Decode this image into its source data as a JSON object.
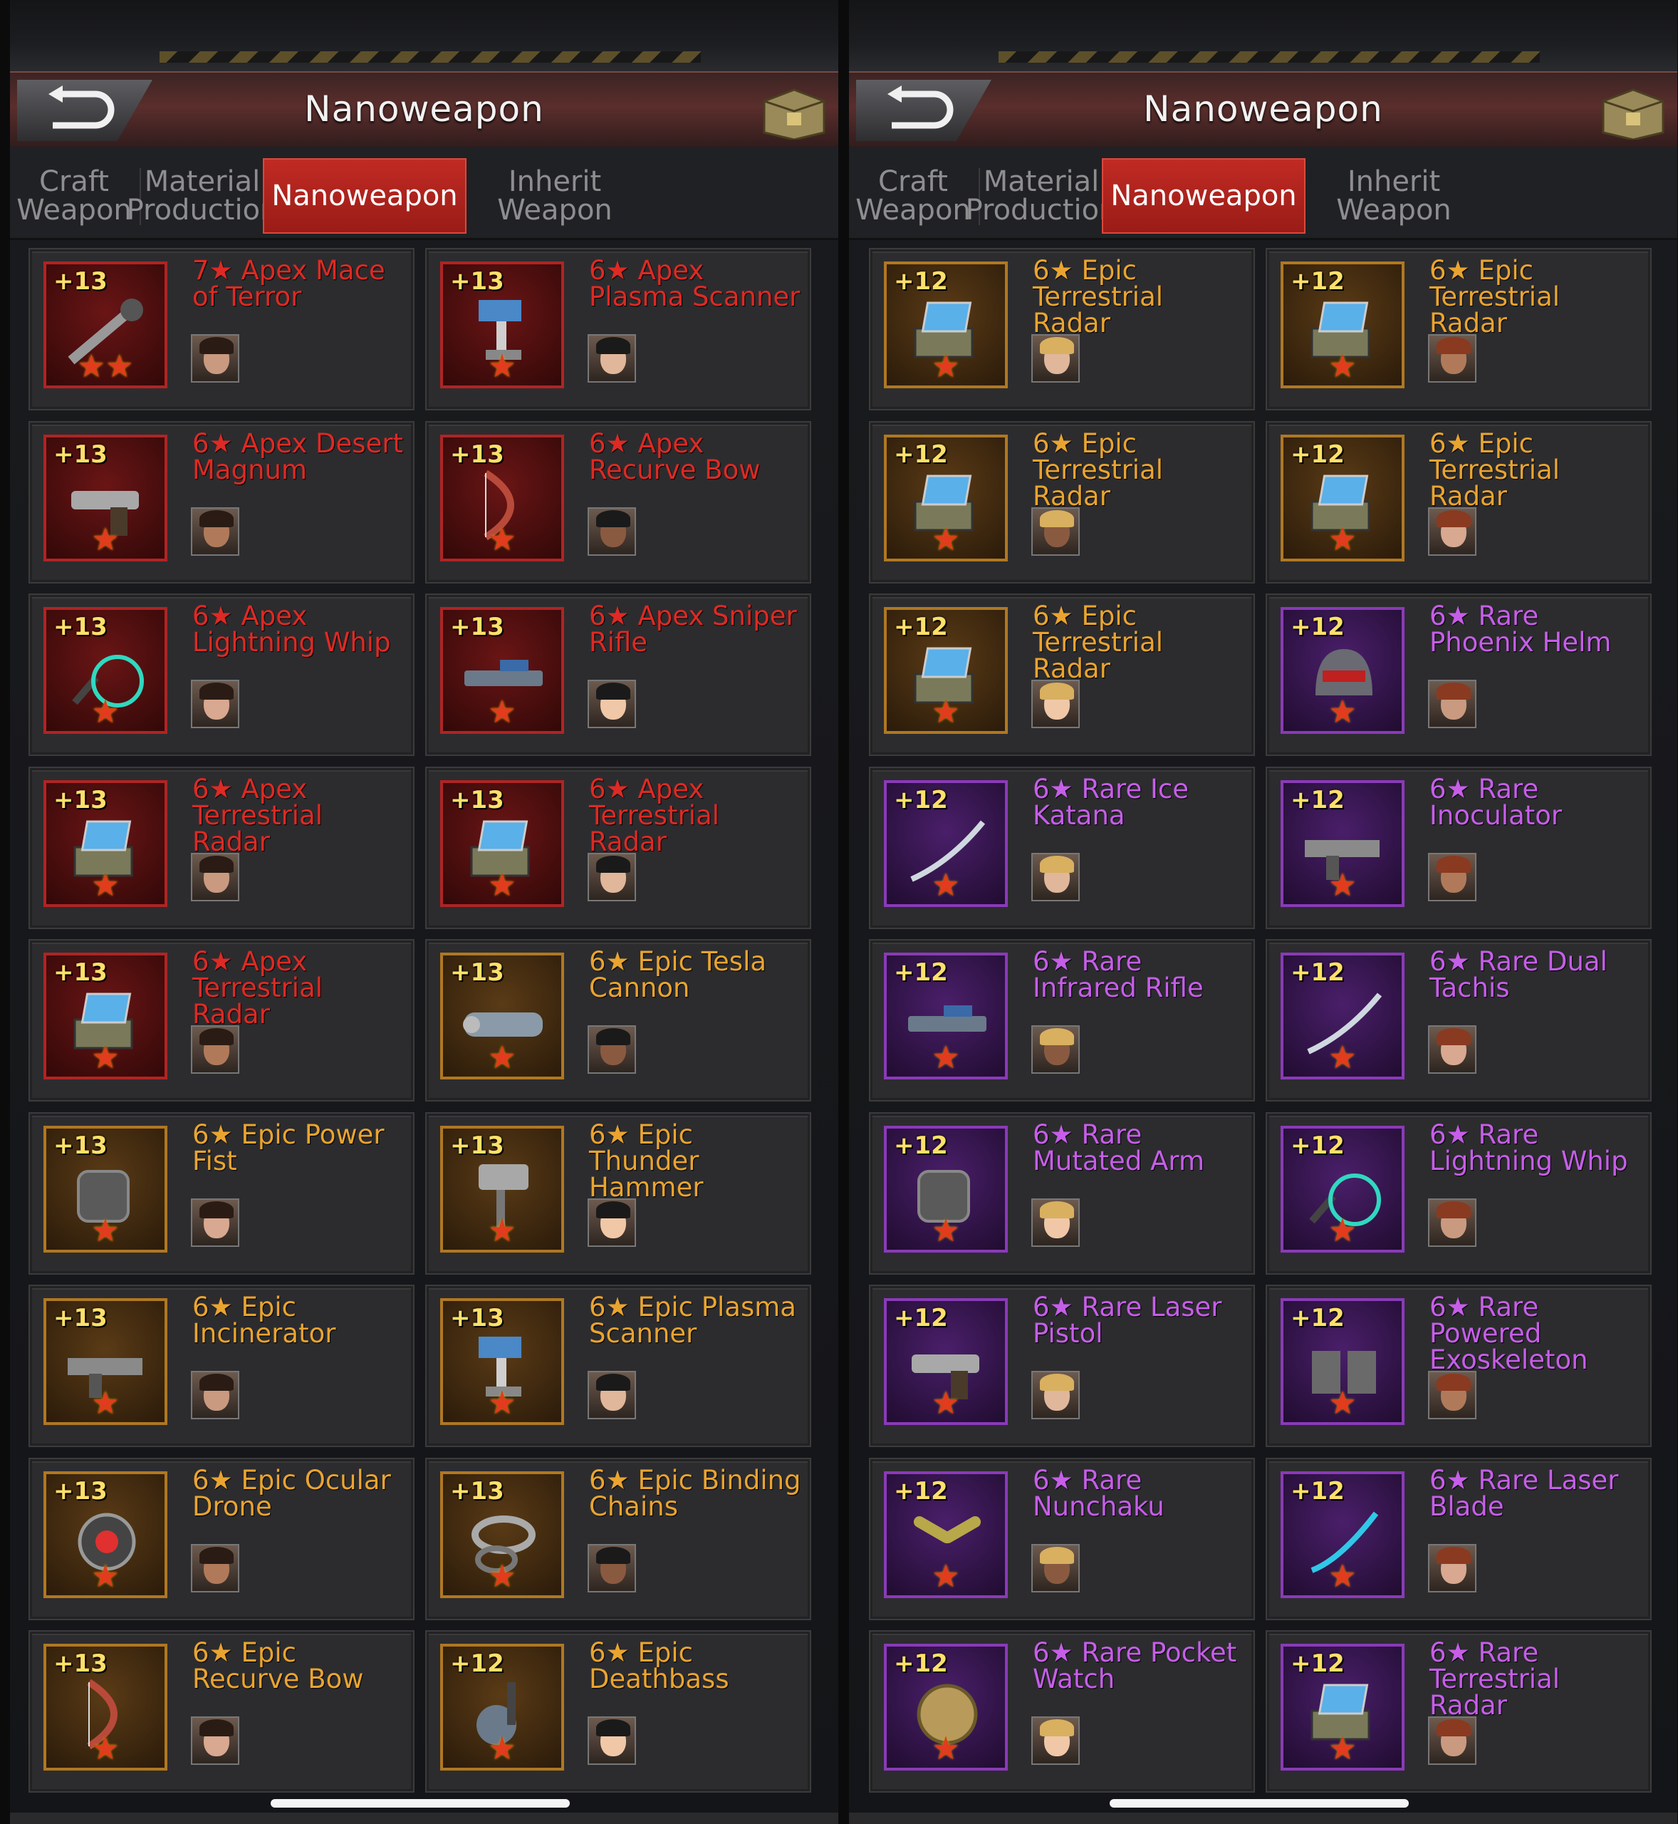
{
  "panels": [
    {
      "title": "Nanoweapon",
      "tabs": [
        {
          "label": "Craft Weapon",
          "active": false
        },
        {
          "label": "Material Production",
          "active": false
        },
        {
          "label": "Nanoweapon",
          "active": true
        },
        {
          "label": "Inherit Weapon",
          "active": false
        }
      ],
      "items": [
        {
          "level": "+13",
          "name": "7★ Apex Mace of Terror",
          "rarity": "apex",
          "stars": "★★",
          "icon": "mace-icon"
        },
        {
          "level": "+13",
          "name": "6★ Apex Plasma Scanner",
          "rarity": "apex",
          "stars": "★",
          "icon": "plasma-scanner-icon"
        },
        {
          "level": "+13",
          "name": "6★ Apex Desert Magnum",
          "rarity": "apex",
          "stars": "★",
          "icon": "pistol-icon"
        },
        {
          "level": "+13",
          "name": "6★ Apex Recurve Bow",
          "rarity": "apex",
          "stars": "★",
          "icon": "bow-icon"
        },
        {
          "level": "+13",
          "name": "6★ Apex Lightning Whip",
          "rarity": "apex",
          "stars": "★",
          "icon": "whip-icon"
        },
        {
          "level": "+13",
          "name": "6★ Apex Sniper Rifle",
          "rarity": "apex",
          "stars": "★",
          "icon": "rifle-icon"
        },
        {
          "level": "+13",
          "name": "6★ Apex Terrestrial Radar",
          "rarity": "apex",
          "stars": "★",
          "icon": "radar-icon"
        },
        {
          "level": "+13",
          "name": "6★ Apex Terrestrial Radar",
          "rarity": "apex",
          "stars": "★",
          "icon": "radar-icon"
        },
        {
          "level": "+13",
          "name": "6★ Apex Terrestrial Radar",
          "rarity": "apex",
          "stars": "★",
          "icon": "radar-icon"
        },
        {
          "level": "+13",
          "name": "6★ Epic Tesla Cannon",
          "rarity": "epic",
          "stars": "★",
          "icon": "cannon-icon"
        },
        {
          "level": "+13",
          "name": "6★ Epic Power Fist",
          "rarity": "epic",
          "stars": "★",
          "icon": "fist-icon"
        },
        {
          "level": "+13",
          "name": "6★ Epic Thunder Hammer",
          "rarity": "epic",
          "stars": "★",
          "icon": "hammer-icon"
        },
        {
          "level": "+13",
          "name": "6★ Epic Incinerator",
          "rarity": "epic",
          "stars": "★",
          "icon": "gun-icon"
        },
        {
          "level": "+13",
          "name": "6★ Epic Plasma Scanner",
          "rarity": "epic",
          "stars": "★",
          "icon": "plasma-scanner-icon"
        },
        {
          "level": "+13",
          "name": "6★ Epic Ocular Drone",
          "rarity": "epic",
          "stars": "★",
          "icon": "drone-icon"
        },
        {
          "level": "+13",
          "name": "6★ Epic Binding Chains",
          "rarity": "epic",
          "stars": "★",
          "icon": "chains-icon"
        },
        {
          "level": "+13",
          "name": "6★ Epic Recurve Bow",
          "rarity": "epic",
          "stars": "★",
          "icon": "bow-icon"
        },
        {
          "level": "+12",
          "name": "6★ Epic Deathbass",
          "rarity": "epic",
          "stars": "★",
          "icon": "guitar-icon"
        }
      ]
    },
    {
      "title": "Nanoweapon",
      "tabs": [
        {
          "label": "Craft Weapon",
          "active": false
        },
        {
          "label": "Material Production",
          "active": false
        },
        {
          "label": "Nanoweapon",
          "active": true
        },
        {
          "label": "Inherit Weapon",
          "active": false
        }
      ],
      "items": [
        {
          "level": "+12",
          "name": "6★ Epic Terrestrial Radar",
          "rarity": "epic",
          "stars": "★",
          "icon": "radar-icon"
        },
        {
          "level": "+12",
          "name": "6★ Epic Terrestrial Radar",
          "rarity": "epic",
          "stars": "★",
          "icon": "radar-icon"
        },
        {
          "level": "+12",
          "name": "6★ Epic Terrestrial Radar",
          "rarity": "epic",
          "stars": "★",
          "icon": "radar-icon"
        },
        {
          "level": "+12",
          "name": "6★ Epic Terrestrial Radar",
          "rarity": "epic",
          "stars": "★",
          "icon": "radar-icon"
        },
        {
          "level": "+12",
          "name": "6★ Epic Terrestrial Radar",
          "rarity": "epic",
          "stars": "★",
          "icon": "radar-icon"
        },
        {
          "level": "+12",
          "name": "6★ Rare Phoenix Helm",
          "rarity": "rare",
          "stars": "★",
          "icon": "helm-icon"
        },
        {
          "level": "+12",
          "name": "6★ Rare Ice Katana",
          "rarity": "rare",
          "stars": "★",
          "icon": "katana-icon"
        },
        {
          "level": "+12",
          "name": "6★ Rare Inoculator",
          "rarity": "rare",
          "stars": "★",
          "icon": "gun-icon"
        },
        {
          "level": "+12",
          "name": "6★ Rare Infrared Rifle",
          "rarity": "rare",
          "stars": "★",
          "icon": "rifle-icon"
        },
        {
          "level": "+12",
          "name": "6★ Rare Dual Tachis",
          "rarity": "rare",
          "stars": "★",
          "icon": "katana-icon"
        },
        {
          "level": "+12",
          "name": "6★ Rare Mutated Arm",
          "rarity": "rare",
          "stars": "★",
          "icon": "fist-icon"
        },
        {
          "level": "+12",
          "name": "6★ Rare Lightning Whip",
          "rarity": "rare",
          "stars": "★",
          "icon": "whip-icon"
        },
        {
          "level": "+12",
          "name": "6★ Rare Laser Pistol",
          "rarity": "rare",
          "stars": "★",
          "icon": "pistol-icon"
        },
        {
          "level": "+12",
          "name": "6★ Rare Powered Exoskeleton",
          "rarity": "rare",
          "stars": "★",
          "icon": "exoskeleton-icon"
        },
        {
          "level": "+12",
          "name": "6★ Rare Nunchaku",
          "rarity": "rare",
          "stars": "★",
          "icon": "nunchaku-icon"
        },
        {
          "level": "+12",
          "name": "6★ Rare Laser Blade",
          "rarity": "rare",
          "stars": "★",
          "icon": "blade-icon"
        },
        {
          "level": "+12",
          "name": "6★ Rare Pocket Watch",
          "rarity": "rare",
          "stars": "★",
          "icon": "watch-icon"
        },
        {
          "level": "+12",
          "name": "6★ Rare Terrestrial Radar",
          "rarity": "rare",
          "stars": "★",
          "icon": "radar-icon"
        }
      ]
    }
  ],
  "colors": {
    "apex": "#dd2a24",
    "epic": "#e9a430",
    "rare": "#c65ee8",
    "active_tab": "#b5231d"
  }
}
